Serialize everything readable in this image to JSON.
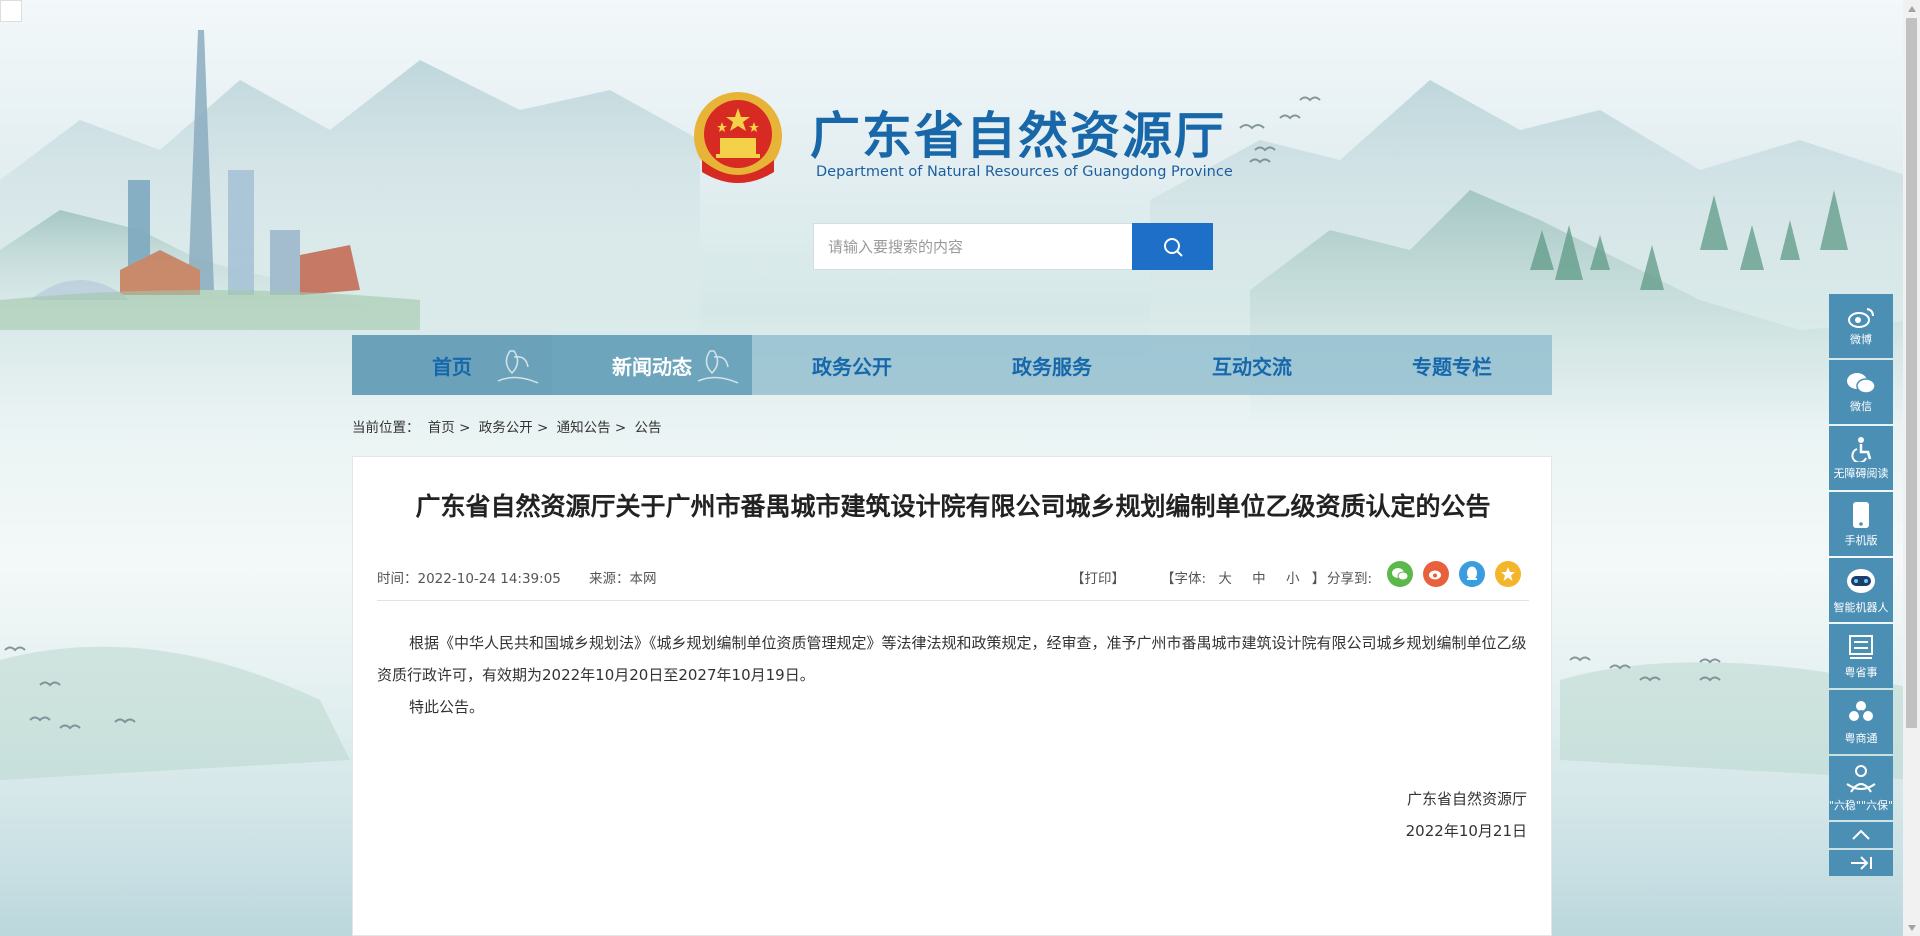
{
  "site": {
    "title": "广东省自然资源厅",
    "subtitle": "Department of Natural Resources of Guangdong Province"
  },
  "search": {
    "placeholder": "请输入要搜索的内容"
  },
  "nav": {
    "items": [
      {
        "label": "首页"
      },
      {
        "label": "新闻动态"
      },
      {
        "label": "政务公开"
      },
      {
        "label": "政务服务"
      },
      {
        "label": "互动交流"
      },
      {
        "label": "专题专栏"
      }
    ]
  },
  "breadcrumb": {
    "prefix": "当前位置：",
    "items": [
      "首页",
      "政务公开",
      "通知公告",
      "公告"
    ],
    "separator": ">"
  },
  "article": {
    "title": "广东省自然资源厅关于广州市番禺城市建筑设计院有限公司城乡规划编制单位乙级资质认定的公告",
    "time": "时间：2022-10-24 14:39:05",
    "source": "来源：本网",
    "print": "【打印】",
    "font_prefix": "【字体:",
    "font_large": "大",
    "font_medium": "中",
    "font_small": "小",
    "font_suffix": "】",
    "share_label": "分享到:",
    "paragraph1": "根据《中华人民共和国城乡规划法》《城乡规划编制单位资质管理规定》等法律法规和政策规定，经审查，准予广州市番禺城市建筑设计院有限公司城乡规划编制单位乙级资质行政许可，有效期为2022年10月20日至2027年10月19日。",
    "paragraph2": "特此公告。",
    "signer": "广东省自然资源厅",
    "date": "2022年10月21日"
  },
  "share": {
    "icons": [
      {
        "name": "wechat-share-icon",
        "color": "#5bb84a"
      },
      {
        "name": "weibo-share-icon",
        "color": "#e8603c"
      },
      {
        "name": "qq-share-icon",
        "color": "#3b9de0"
      },
      {
        "name": "qzone-share-icon",
        "color": "#f3b52a"
      }
    ]
  },
  "sidebar": {
    "items": [
      {
        "label": "微博",
        "icon": "weibo-icon"
      },
      {
        "label": "微信",
        "icon": "wechat-icon"
      },
      {
        "label": "无障碍阅读",
        "icon": "accessibility-icon"
      },
      {
        "label": "手机版",
        "icon": "mobile-icon"
      },
      {
        "label": "智能机器人",
        "icon": "robot-icon"
      },
      {
        "label": "粤省事",
        "icon": "yueshengshi-icon"
      },
      {
        "label": "粤商通",
        "icon": "yueshangtong-icon"
      },
      {
        "label": "\"六稳\"\"六保\"",
        "icon": "liuwen-liubao-icon"
      }
    ]
  },
  "colors": {
    "brand_blue": "#1867a8",
    "nav_bg": "#8bbacc",
    "nav_active": "#6aa3bc",
    "search_button": "#1d6fc8",
    "sidebar_bg": "#4c8fb5"
  }
}
